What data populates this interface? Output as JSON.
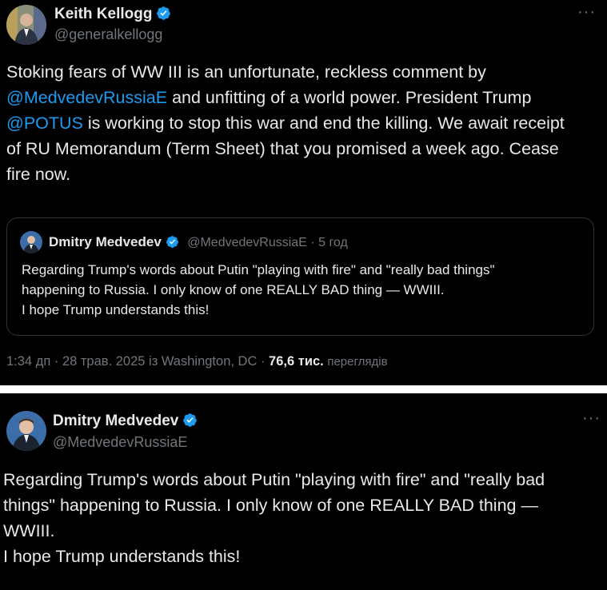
{
  "tweet1": {
    "author_name": "Keith Kellogg",
    "handle": "@generalkellogg",
    "more": "···",
    "lines": [
      [
        {
          "t": "Stoking fears of WW III is an unfortunate, reckless comment by"
        }
      ],
      [
        {
          "t": "@MedvedevRussiaE",
          "mention": true
        },
        {
          "t": " and unfitting of a world power. President Trump"
        }
      ],
      [
        {
          "t": "@POTUS",
          "mention": true
        },
        {
          "t": " is working to stop this war and end the killing. We await receipt"
        }
      ],
      [
        {
          "t": "of RU Memorandum (Term Sheet) that you promised a week ago. Cease"
        }
      ],
      [
        {
          "t": "fire now."
        }
      ]
    ],
    "quote": {
      "author_name": "Dmitry Medvedev",
      "handle": "@MedvedevRussiaE",
      "separator": " · ",
      "time": "5 год",
      "lines": [
        "Regarding Trump's words about Putin \"playing with fire\" and \"really bad things\"",
        "happening to Russia. I only know of one REALLY BAD thing — WWIII.",
        "I hope Trump understands this!"
      ]
    },
    "meta": {
      "time": "1:34 дп",
      "separator": " · ",
      "date": "28 трав. 2025",
      "location": "із Washington, DC",
      "views_count": "76,6 тис.",
      "views_label": "переглядів"
    }
  },
  "tweet2": {
    "author_name": "Dmitry Medvedev",
    "handle": "@MedvedevRussiaE",
    "more": "···",
    "lines": [
      "Regarding Trump's words about Putin \"playing with fire\" and \"really bad",
      "things\" happening to Russia. I only know of one REALLY BAD thing —",
      "WWIII.",
      "I hope Trump understands this!"
    ]
  },
  "colors": {
    "background": "#000000",
    "text": "#e7e9ea",
    "muted": "#71767b",
    "link": "#1d9bf0",
    "verified": "#1d9bf0",
    "border": "#2f3336"
  }
}
